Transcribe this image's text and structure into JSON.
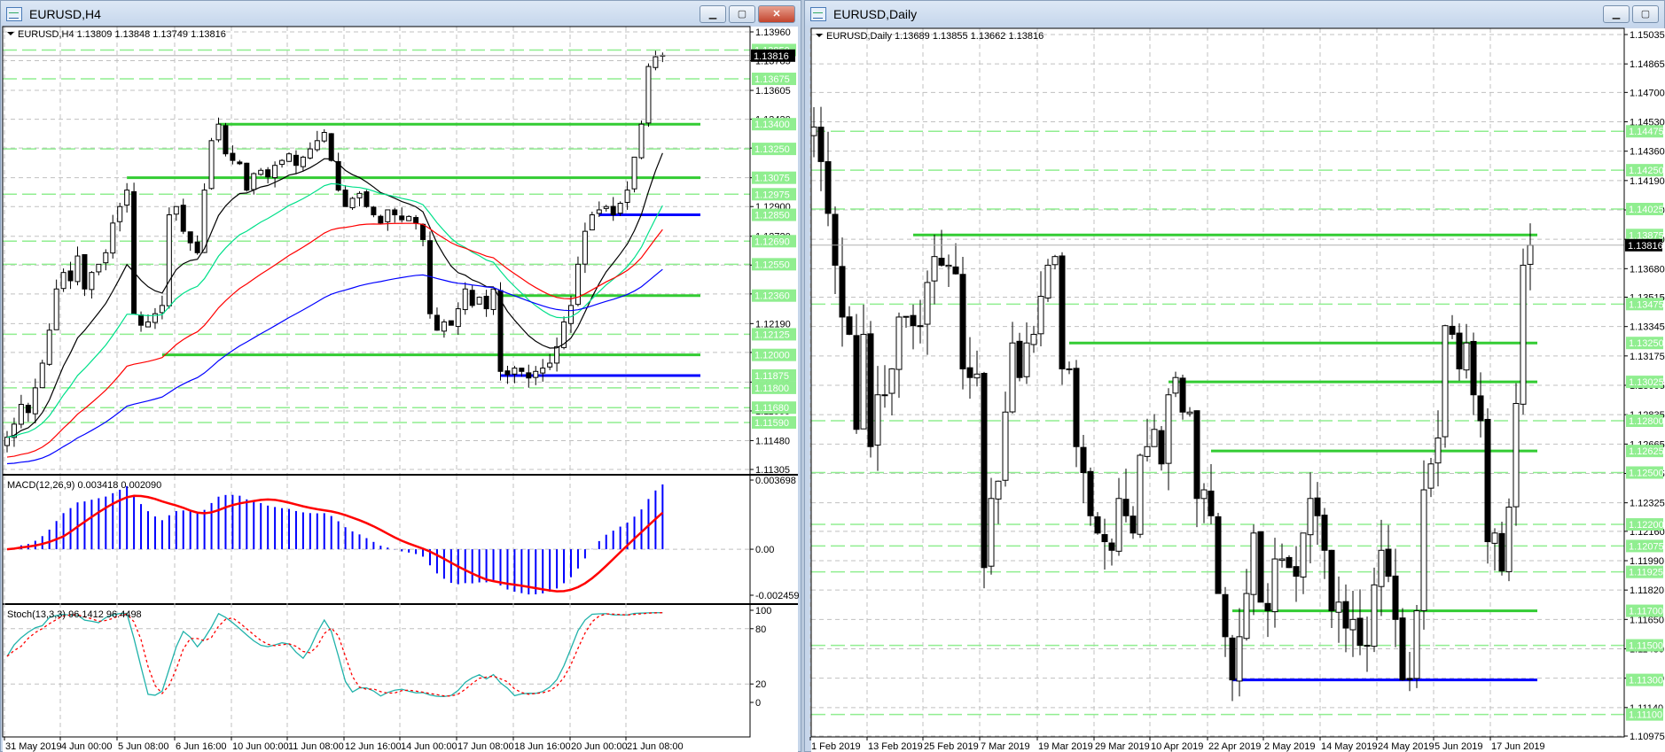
{
  "left": {
    "title": "EURUSD,H4",
    "info": "EURUSD,H4  1.13809 1.13848 1.13749 1.13816",
    "buttons": {
      "minimize": "▁",
      "restore": "▢",
      "close": "✕"
    },
    "price_range": [
      1.11305,
      1.1396
    ],
    "price_ticks": [
      "1.13960",
      "1.13785",
      "1.13605",
      "1.13430",
      "1.13255",
      "1.13075",
      "1.12900",
      "1.12720",
      "1.12545",
      "1.12370",
      "1.12190",
      "1.12015",
      "1.11835",
      "1.11660",
      "1.11480",
      "1.11305"
    ],
    "current_price": "1.13816",
    "levels_thick": [
      {
        "price": "1.13400",
        "color": "#33cc33",
        "from": 30
      },
      {
        "price": "1.13075",
        "color": "#33cc33",
        "from": 17
      },
      {
        "price": "1.12360",
        "color": "#33cc33",
        "from": 70
      },
      {
        "price": "1.12000",
        "color": "#33cc33",
        "from": 22
      },
      {
        "price": "1.12850",
        "color": "#0000ff",
        "from": 84
      },
      {
        "price": "1.11875",
        "color": "#0000ff",
        "from": 70
      }
    ],
    "levels_dashed": [
      "1.13850",
      "1.13675",
      "1.13250",
      "1.12975",
      "1.12690",
      "1.12550",
      "1.12125",
      "1.11800",
      "1.11680",
      "1.11590"
    ],
    "time_labels": [
      "31 May 2019",
      "4 Jun 00:00",
      "5 Jun 08:00",
      "6 Jun 16:00",
      "10 Jun 00:00",
      "11 Jun 08:00",
      "12 Jun 16:00",
      "14 Jun 00:00",
      "17 Jun 08:00",
      "18 Jun 16:00",
      "20 Jun 00:00",
      "21 Jun 08:00"
    ],
    "closes": [
      1.115,
      1.1158,
      1.117,
      1.1165,
      1.118,
      1.1195,
      1.1215,
      1.124,
      1.125,
      1.1245,
      1.126,
      1.124,
      1.125,
      1.1255,
      1.1262,
      1.128,
      1.129,
      1.13,
      1.1225,
      1.1218,
      1.122,
      1.1225,
      1.123,
      1.1285,
      1.129,
      1.1275,
      1.1268,
      1.1262,
      1.13,
      1.133,
      1.134,
      1.1322,
      1.1318,
      1.1316,
      1.13,
      1.131,
      1.1312,
      1.1308,
      1.1315,
      1.1318,
      1.1322,
      1.1315,
      1.132,
      1.1325,
      1.133,
      1.1335,
      1.1318,
      1.13,
      1.129,
      1.1295,
      1.1298,
      1.129,
      1.1285,
      1.128,
      1.1288,
      1.1285,
      1.1282,
      1.1284,
      1.128,
      1.127,
      1.1225,
      1.1215,
      1.122,
      1.1218,
      1.1228,
      1.124,
      1.123,
      1.1235,
      1.1228,
      1.124,
      1.119,
      1.1188,
      1.1192,
      1.119,
      1.1186,
      1.119,
      1.1192,
      1.1195,
      1.1205,
      1.122,
      1.123,
      1.1255,
      1.1275,
      1.1285,
      1.1288,
      1.129,
      1.1285,
      1.1292,
      1.13,
      1.132,
      1.134,
      1.1375,
      1.13809,
      1.13816
    ],
    "ma_colors": [
      "#000000",
      "#00e08a",
      "#ff0000",
      "#0000ff"
    ],
    "macd": {
      "label": "MACD(12,26,9) 0.003418 0.002090",
      "top": "0.003698",
      "zero": "0.00",
      "bottom": "-0.002459",
      "hist_color": "#0000ff",
      "signal_color": "#ff0000"
    },
    "stoch": {
      "label": "Stoch(13,3,3) 96.1412 96.4498",
      "levels": [
        "100",
        "80",
        "20",
        "0"
      ],
      "main_color": "#20b2aa",
      "signal_color": "#ff0000"
    }
  },
  "right": {
    "title": "EURUSD,Daily",
    "info": "EURUSD,Daily  1.13689 1.13855 1.13662 1.13816",
    "buttons": {
      "minimize": "▁",
      "restore": "▢"
    },
    "price_range": [
      1.10975,
      1.15035
    ],
    "price_ticks": [
      "1.15035",
      "1.14865",
      "1.14700",
      "1.14530",
      "1.14360",
      "1.14190",
      "1.14020",
      "1.13850",
      "1.13680",
      "1.13515",
      "1.13345",
      "1.13175",
      "1.13005",
      "1.12835",
      "1.12665",
      "1.12495",
      "1.12325",
      "1.12160",
      "1.11990",
      "1.11820",
      "1.11650",
      "1.11480",
      "1.11310",
      "1.11140",
      "1.10975"
    ],
    "current_price": "1.13816",
    "levels_thick": [
      {
        "price": "1.13875",
        "color": "#33cc33",
        "from": 14
      },
      {
        "price": "1.13250",
        "color": "#33cc33",
        "from": 36
      },
      {
        "price": "1.13025",
        "color": "#33cc33",
        "from": 50
      },
      {
        "price": "1.12625",
        "color": "#33cc33",
        "from": 56
      },
      {
        "price": "1.11700",
        "color": "#33cc33",
        "from": 59
      },
      {
        "price": "1.11300",
        "color": "#0000ff",
        "from": 59
      }
    ],
    "levels_dashed": [
      "1.14475",
      "1.14250",
      "1.14025",
      "1.13475",
      "1.12800",
      "1.12500",
      "1.12200",
      "1.12075",
      "1.11925",
      "1.11500",
      "1.11100"
    ],
    "time_labels": [
      "1 Feb 2019",
      "13 Feb 2019",
      "25 Feb 2019",
      "7 Mar 2019",
      "19 Mar 2019",
      "29 Mar 2019",
      "10 Apr 2019",
      "22 Apr 2019",
      "2 May 2019",
      "14 May 2019",
      "24 May 2019",
      "5 Jun 2019",
      "17 Jun 2019"
    ],
    "closes": [
      1.145,
      1.143,
      1.14,
      1.137,
      1.134,
      1.133,
      1.1275,
      1.133,
      1.1265,
      1.1295,
      1.1295,
      1.131,
      1.134,
      1.134,
      1.1335,
      1.1335,
      1.136,
      1.1375,
      1.137,
      1.137,
      1.1365,
      1.131,
      1.1305,
      1.1307,
      1.1195,
      1.1235,
      1.1245,
      1.1285,
      1.1325,
      1.1305,
      1.1325,
      1.133,
      1.1352,
      1.137,
      1.1375,
      1.131,
      1.131,
      1.1265,
      1.125,
      1.1225,
      1.1215,
      1.121,
      1.1205,
      1.1235,
      1.1225,
      1.1215,
      1.126,
      1.1265,
      1.1275,
      1.1255,
      1.1295,
      1.1305,
      1.1285,
      1.1285,
      1.1235,
      1.124,
      1.1225,
      1.118,
      1.1155,
      1.113,
      1.1155,
      1.118,
      1.1215,
      1.1175,
      1.117,
      1.12,
      1.12,
      1.1195,
      1.119,
      1.1215,
      1.1235,
      1.1225,
      1.1205,
      1.117,
      1.1175,
      1.116,
      1.1165,
      1.115,
      1.115,
      1.1185,
      1.1205,
      1.119,
      1.1165,
      1.113,
      1.113,
      1.117,
      1.124,
      1.1255,
      1.127,
      1.1335,
      1.133,
      1.131,
      1.1325,
      1.1295,
      1.128,
      1.121,
      1.1215,
      1.1193,
      1.123,
      1.129,
      1.137,
      1.13816
    ]
  }
}
